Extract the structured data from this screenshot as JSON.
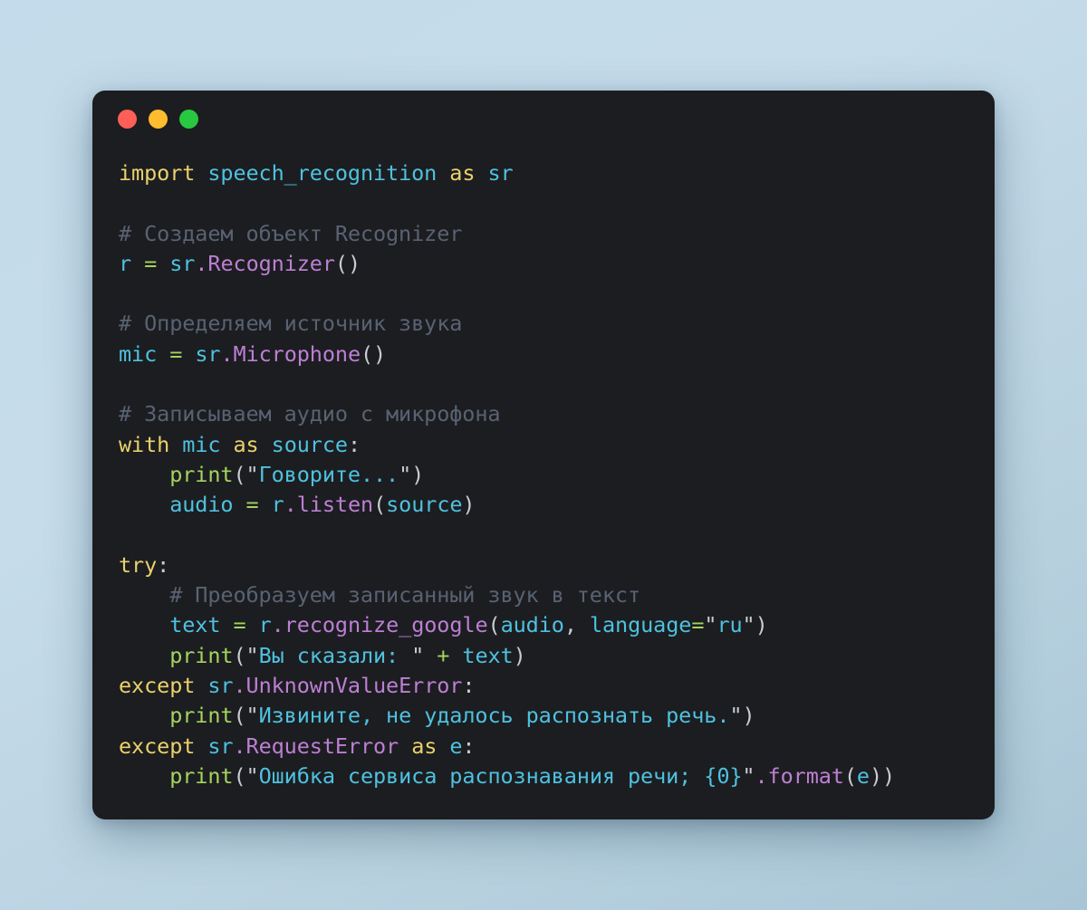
{
  "window": {
    "title": "code-snippet",
    "dots": [
      {
        "name": "close-dot",
        "color": "#ff5f57"
      },
      {
        "name": "minimize-dot",
        "color": "#febc2e"
      },
      {
        "name": "maximize-dot",
        "color": "#28c840"
      }
    ]
  },
  "theme": {
    "background": "#c5dceb",
    "card_background": "#1c1d20",
    "keyword": "#e9d16c",
    "identifier": "#4ec1e0",
    "string": "#4ec1e0",
    "operator": "#a5d45f",
    "builtin": "#a5d45f",
    "attribute": "#bd7fd4",
    "comment": "#596273",
    "punctuation": "#c8ccd2"
  },
  "code": {
    "language": "python",
    "lines": [
      "import speech_recognition as sr",
      "",
      "# Создаем объект Recognizer",
      "r = sr.Recognizer()",
      "",
      "# Определяем источник звука",
      "mic = sr.Microphone()",
      "",
      "# Записываем аудио с микрофона",
      "with mic as source:",
      "    print(\"Говорите...\")",
      "    audio = r.listen(source)",
      "",
      "try:",
      "    # Преобразуем записанный звук в текст",
      "    text = r.recognize_google(audio, language=\"ru\")",
      "    print(\"Вы сказали: \" + text)",
      "except sr.UnknownValueError:",
      "    print(\"Извините, не удалось распознать речь.\")",
      "except sr.RequestError as e:",
      "    print(\"Ошибка сервиса распознавания речи; {0}\".format(e))"
    ],
    "tokens": {
      "l1": {
        "kw1": "import",
        "id1": "speech_recognition",
        "kw2": "as",
        "id2": "sr"
      },
      "l3": {
        "comment": "# Создаем объект Recognizer"
      },
      "l4": {
        "var": "r",
        "eq": "=",
        "mod": "sr",
        "dot": ".",
        "cls": "Recognizer",
        "parens": "()"
      },
      "l6": {
        "comment": "# Определяем источник звука"
      },
      "l7": {
        "var": "mic",
        "eq": "=",
        "mod": "sr",
        "dot": ".",
        "cls": "Microphone",
        "parens": "()"
      },
      "l9": {
        "comment": "# Записываем аудио с микрофона"
      },
      "l10": {
        "kw1": "with",
        "id1": "mic",
        "kw2": "as",
        "id2": "source",
        "colon": ":"
      },
      "l11": {
        "fn": "print",
        "open": "(",
        "quote1": "\"",
        "str": "Говорите...",
        "quote2": "\"",
        "close": ")"
      },
      "l12": {
        "var": "audio",
        "eq": "=",
        "obj": "r",
        "dot": ".",
        "meth": "listen",
        "open": "(",
        "arg": "source",
        "close": ")"
      },
      "l14": {
        "kw": "try",
        "colon": ":"
      },
      "l15": {
        "comment": "# Преобразуем записанный звук в текст"
      },
      "l16": {
        "var": "text",
        "eq": "=",
        "obj": "r",
        "dot": ".",
        "meth": "recognize_google",
        "open": "(",
        "arg1": "audio",
        "comma": ", ",
        "kwarg": "language",
        "eq2": "=",
        "quote1": "\"",
        "str": "ru",
        "quote2": "\"",
        "close": ")"
      },
      "l17": {
        "fn": "print",
        "open": "(",
        "quote1": "\"",
        "str": "Вы сказали: ",
        "quote2": "\"",
        "plus": " + ",
        "var": "text",
        "close": ")"
      },
      "l18": {
        "kw": "except",
        "mod": "sr",
        "dot": ".",
        "cls": "UnknownValueError",
        "colon": ":"
      },
      "l19": {
        "fn": "print",
        "open": "(",
        "quote1": "\"",
        "str": "Извините, не удалось распознать речь.",
        "quote2": "\"",
        "close": ")"
      },
      "l20": {
        "kw1": "except",
        "mod": "sr",
        "dot": ".",
        "cls": "RequestError",
        "kw2": "as",
        "id": "e",
        "colon": ":"
      },
      "l21": {
        "fn": "print",
        "open": "(",
        "quote1": "\"",
        "str": "Ошибка сервиса распознавания речи; {0}",
        "quote2": "\"",
        "dot": ".",
        "meth": "format",
        "open2": "(",
        "arg": "e",
        "close": "))"
      }
    }
  }
}
